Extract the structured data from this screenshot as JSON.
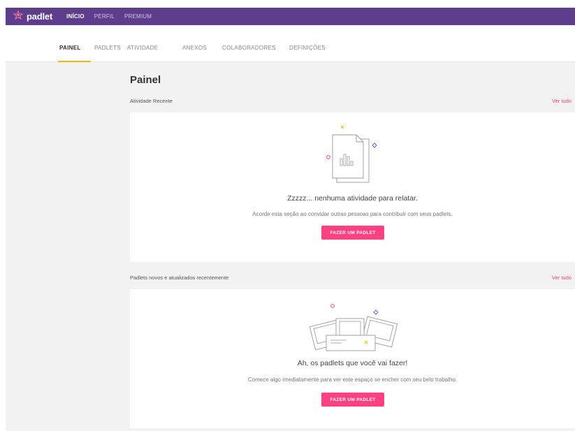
{
  "colors": {
    "brand": "#5e3d8c",
    "accent": "#ff4081",
    "tab_indicator": "#f5b800"
  },
  "header": {
    "logo_text": "padlet",
    "logo_icon": "padlet-flower-icon",
    "nav": [
      "INÍCIO",
      "PERFIL",
      "PREMIUM"
    ]
  },
  "tabs": [
    "PAINEL",
    "PADLETS",
    "ATIVIDADE",
    "ANEXOS",
    "COLABORADORES",
    "DEFINIÇÕES"
  ],
  "dashboard": {
    "title": "Painel",
    "recent_activity": {
      "label": "Atividade Recente",
      "see_all": "Ver tudo",
      "empty_title": "Zzzzz... nenhuma atividade para relatar.",
      "empty_text": "Acorde esta seção ao convidar outras pessoas para contribuir com seus padlets.",
      "cta": "FAZER UM PADLET",
      "illustration": "sleeping-document-icon"
    },
    "recent_padlets": {
      "label": "Padlets novos e atualizados recentemente",
      "see_all": "Ver tudo",
      "empty_title": "Ah, os padlets que você vai fazer!",
      "empty_text": "Comece algo imediatamente para ver este espaço se encher com seu belo trabalho.",
      "cta": "FAZER UM PADLET",
      "illustration": "padlet-boards-icon"
    }
  }
}
